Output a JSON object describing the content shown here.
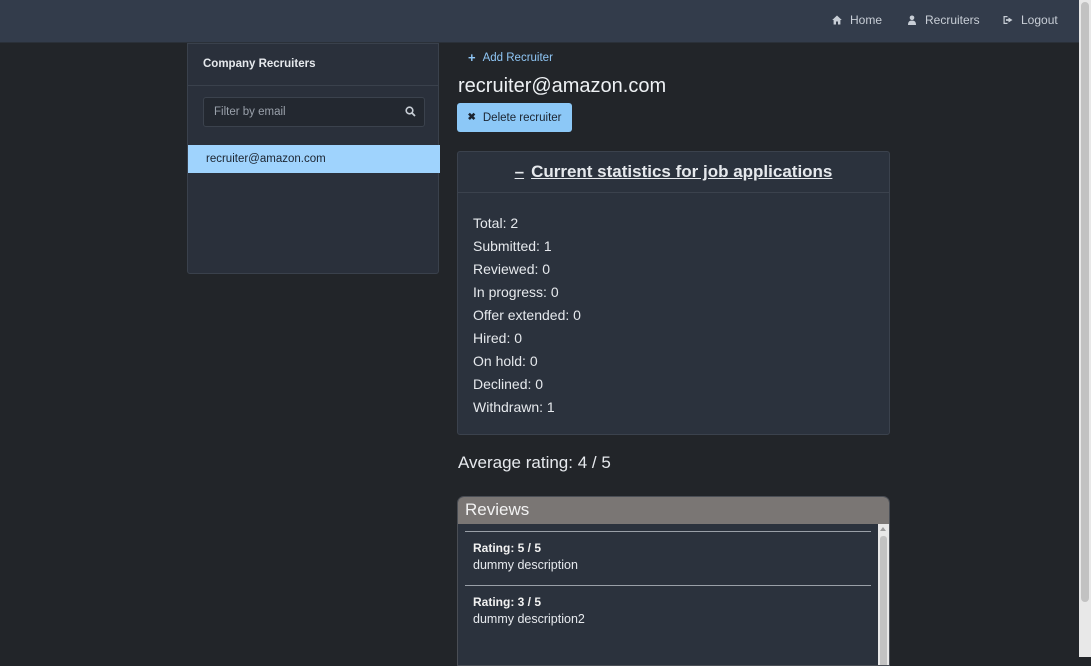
{
  "navbar": {
    "items": [
      {
        "label": "Home",
        "icon": "home-icon"
      },
      {
        "label": "Recruiters",
        "icon": "user-icon"
      },
      {
        "label": "Logout",
        "icon": "logout-icon"
      }
    ]
  },
  "sidebar": {
    "title": "Company Recruiters",
    "filter": {
      "placeholder": "Filter by email",
      "value": ""
    },
    "items": [
      {
        "label": "recruiter@amazon.com",
        "selected": true
      }
    ]
  },
  "main": {
    "add_label": "Add Recruiter",
    "recruiter_email": "recruiter@amazon.com",
    "delete_label": "Delete recruiter",
    "stats": {
      "toggle": "–",
      "title": "Current statistics for job applications",
      "lines": [
        "Total: 2",
        "Submitted: 1",
        "Reviewed: 0",
        "In progress: 0",
        "Offer extended: 0",
        "Hired: 0",
        "On hold: 0",
        "Declined: 0",
        "Withdrawn: 1"
      ]
    },
    "average_rating": "Average rating: 4 / 5",
    "reviews": {
      "title": "Reviews",
      "items": [
        {
          "rating": "Rating: 5 / 5",
          "description": "dummy description"
        },
        {
          "rating": "Rating: 3 / 5",
          "description": "dummy description2"
        }
      ]
    }
  },
  "colors": {
    "background": "#222529",
    "navbar": "#333c4b",
    "panel": "#2b323d",
    "accent": "#9fd3fd",
    "link": "#8fc6f5",
    "reviews_header": "#7a7674"
  }
}
